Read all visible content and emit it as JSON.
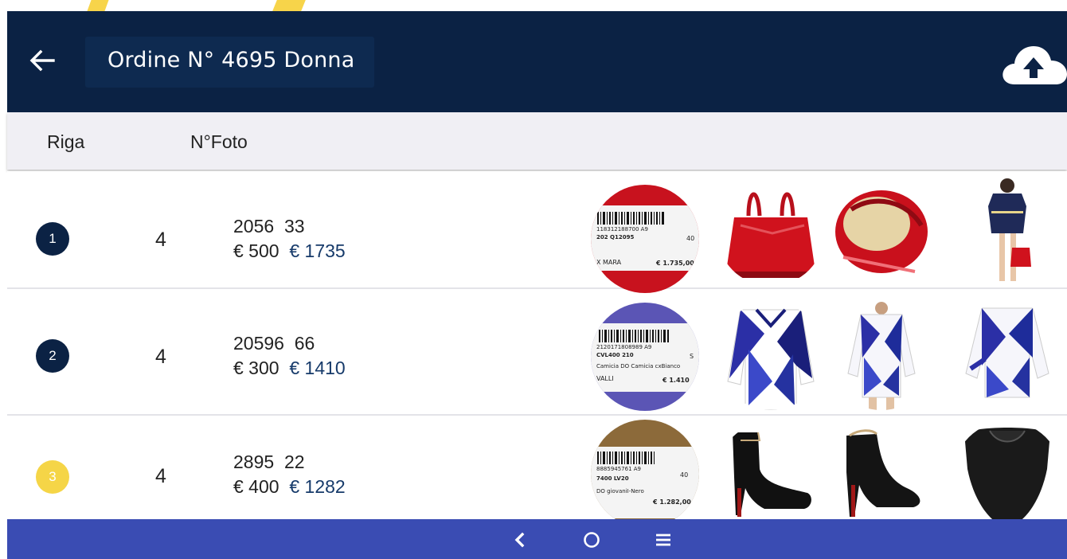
{
  "header": {
    "title": "Ordine N° 4695 Donna",
    "back_icon": "arrow-left-icon",
    "upload_icon": "cloud-upload-icon"
  },
  "columns": {
    "riga": "Riga",
    "n_foto": "N°Foto"
  },
  "rows": [
    {
      "badge": "1",
      "badge_color": "#0b2244",
      "count": "4",
      "code": "2056",
      "size": "33",
      "price": "€ 500",
      "total": "€ 1735",
      "label": {
        "barcode": "118312188700  A9",
        "line1": "202  Q12095",
        "size": "40",
        "brand": "X MARA",
        "price": "€ 1.735,00"
      },
      "photos": [
        "red-handbag",
        "red-handbag-open",
        "model-with-handbag"
      ]
    },
    {
      "badge": "2",
      "badge_color": "#0b2244",
      "count": "4",
      "code": "20596",
      "size": "66",
      "price": "€ 300",
      "total": "€ 1410",
      "label": {
        "barcode": "2120171808989  A9",
        "line1": "CVL400  210",
        "size": "S",
        "line2": "Camicia DO Camicia cxBianco",
        "brand": "VALLI",
        "price": "€ 1.410"
      },
      "photos": [
        "blue-white-top-front",
        "blue-white-top-model",
        "blue-white-top-back"
      ]
    },
    {
      "badge": "3",
      "badge_color": "#f5d547",
      "count": "4",
      "code": "2895",
      "size": "22",
      "price": "€ 400",
      "total": "€ 1282",
      "label": {
        "barcode": "8885945761  A9",
        "line1": "7400  LV20",
        "size": "40",
        "line2": "DO     giovaniI-Nero",
        "price": "€ 1.282,00"
      },
      "photos": [
        "black-ankle-boot",
        "black-ankle-boot-side",
        "black-boot-detail"
      ]
    }
  ],
  "navbar": {
    "icons": [
      "back-chevron-icon",
      "home-circle-icon",
      "menu-lines-icon"
    ]
  },
  "colors": {
    "appbar": "#0b2244",
    "navbar": "#3a4cb3",
    "accent_yellow": "#f5d547"
  }
}
